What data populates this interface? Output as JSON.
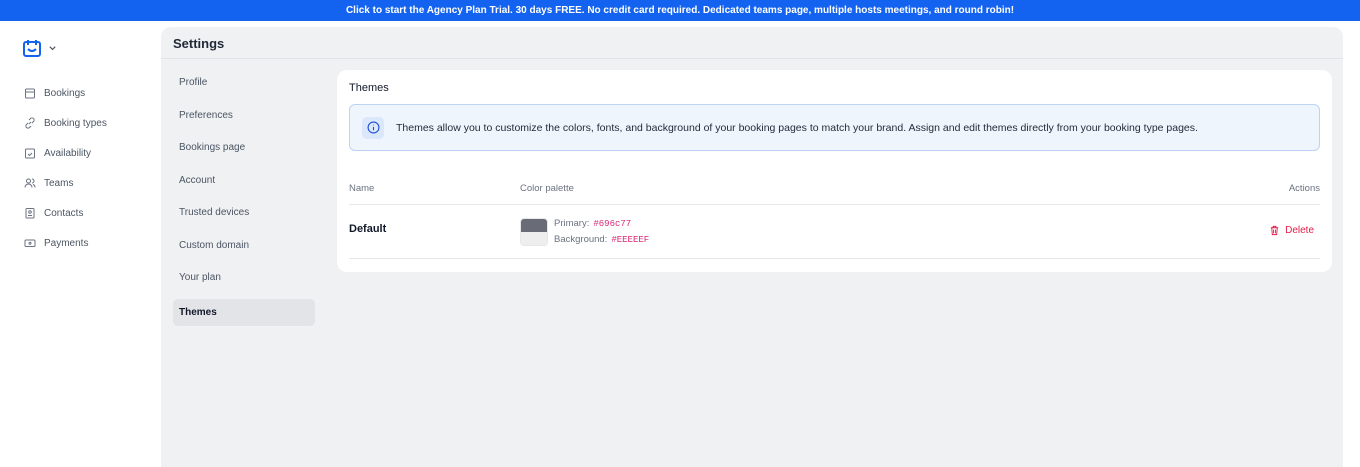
{
  "banner": "Click to start the Agency Plan Trial. 30 days FREE. No credit card required. Dedicated teams page, multiple hosts meetings, and round robin!",
  "nav": [
    {
      "label": "Bookings"
    },
    {
      "label": "Booking types"
    },
    {
      "label": "Availability"
    },
    {
      "label": "Teams"
    },
    {
      "label": "Contacts"
    },
    {
      "label": "Payments"
    }
  ],
  "settings": {
    "title": "Settings",
    "items": [
      "Profile",
      "Preferences",
      "Bookings page",
      "Account",
      "Trusted devices",
      "Custom domain",
      "Your plan",
      "Themes"
    ]
  },
  "themes": {
    "title": "Themes",
    "info": "Themes allow you to customize the colors, fonts, and background of your booking pages to match your brand. Assign and edit themes directly from your booking type pages.",
    "headers": {
      "name": "Name",
      "palette": "Color palette",
      "actions": "Actions"
    },
    "rows": [
      {
        "name": "Default",
        "primary_label": "Primary:",
        "primary": "#696c77",
        "background_label": "Background:",
        "background": "#EEEEEF",
        "delete": "Delete"
      }
    ]
  },
  "colors": {
    "accent": "#1463f0",
    "delete": "#e11d48"
  }
}
